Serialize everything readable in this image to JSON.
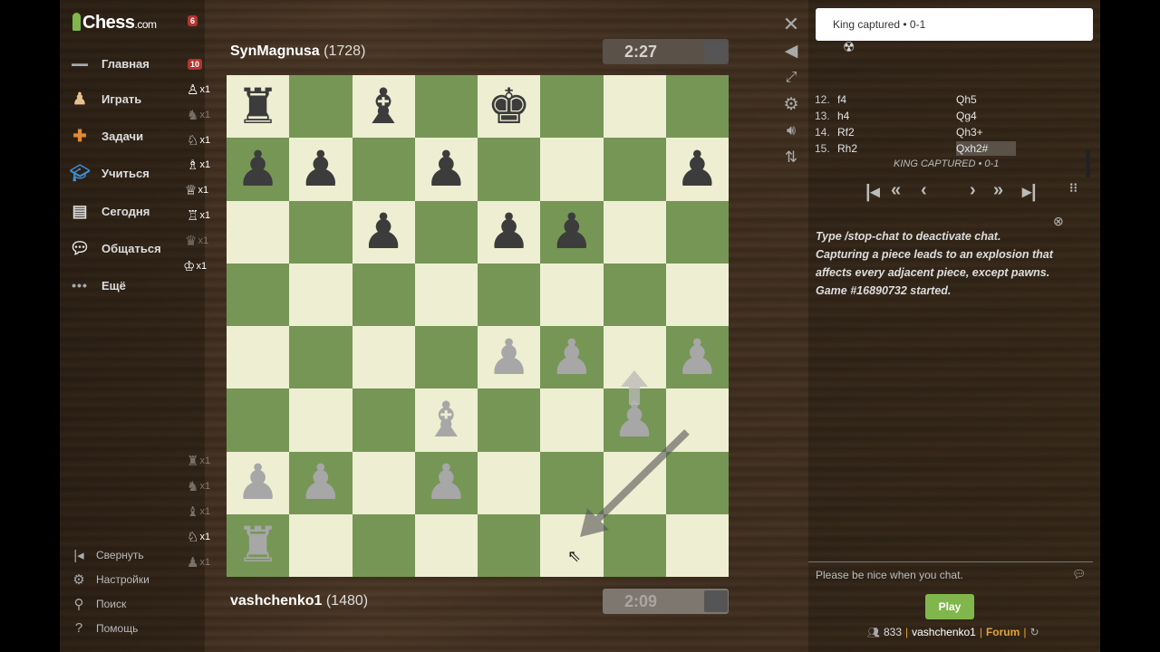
{
  "sidebar": {
    "logo_text": "Chess",
    "logo_suffix": ".com",
    "logo_badge": "6",
    "items": [
      {
        "label": "Главная",
        "icon": "home-icon",
        "badge": "10"
      },
      {
        "label": "Играть",
        "icon": "play-icon"
      },
      {
        "label": "Задачи",
        "icon": "puzzle-icon"
      },
      {
        "label": "Учиться",
        "icon": "learn-icon"
      },
      {
        "label": "Сегодня",
        "icon": "news-icon"
      },
      {
        "label": "Общаться",
        "icon": "social-icon"
      },
      {
        "label": "Ещё",
        "icon": "more-icon"
      }
    ],
    "footer": [
      {
        "label": "Свернуть",
        "icon": "collapse-icon"
      },
      {
        "label": "Настройки",
        "icon": "settings-icon"
      },
      {
        "label": "Поиск",
        "icon": "search-icon"
      },
      {
        "label": "Помощь",
        "icon": "help-icon"
      }
    ]
  },
  "captured_counts": {
    "top": [
      "x1",
      "x1",
      "x1",
      "x1",
      "x1",
      "x1",
      "x1",
      "x1"
    ],
    "bottom": [
      "x1",
      "x1",
      "x1",
      "x1",
      "x1"
    ]
  },
  "top_player": {
    "name": "SynMagnusa",
    "rating": "(1728)",
    "clock": "2:27"
  },
  "bottom_player": {
    "name": "vashchenko1",
    "rating": "(1480)",
    "clock": "2:09"
  },
  "toast": "King captured • 0-1",
  "moves": [
    {
      "num": "12.",
      "white": "f4",
      "black": "Qh5"
    },
    {
      "num": "13.",
      "white": "h4",
      "black": "Qg4"
    },
    {
      "num": "14.",
      "white": "Rf2",
      "black": "Qh3+"
    },
    {
      "num": "15.",
      "white": "Rh2",
      "black": "Qxh2#"
    }
  ],
  "result_text": "KING CAPTURED • 0-1",
  "chat_messages": [
    "Type /stop-chat to deactivate chat.",
    "Capturing a piece leads to an explosion that affects every adjacent piece, except pawns.",
    "Game #16890732 started."
  ],
  "chat_placeholder": "Please be nice when you chat.",
  "play_label": "Play",
  "status": {
    "online": "833",
    "user": "vashchenko1",
    "forum": "Forum"
  },
  "colors": {
    "light_square": "#eeeed2",
    "dark_square": "#769656",
    "accent": "#81b64c"
  }
}
